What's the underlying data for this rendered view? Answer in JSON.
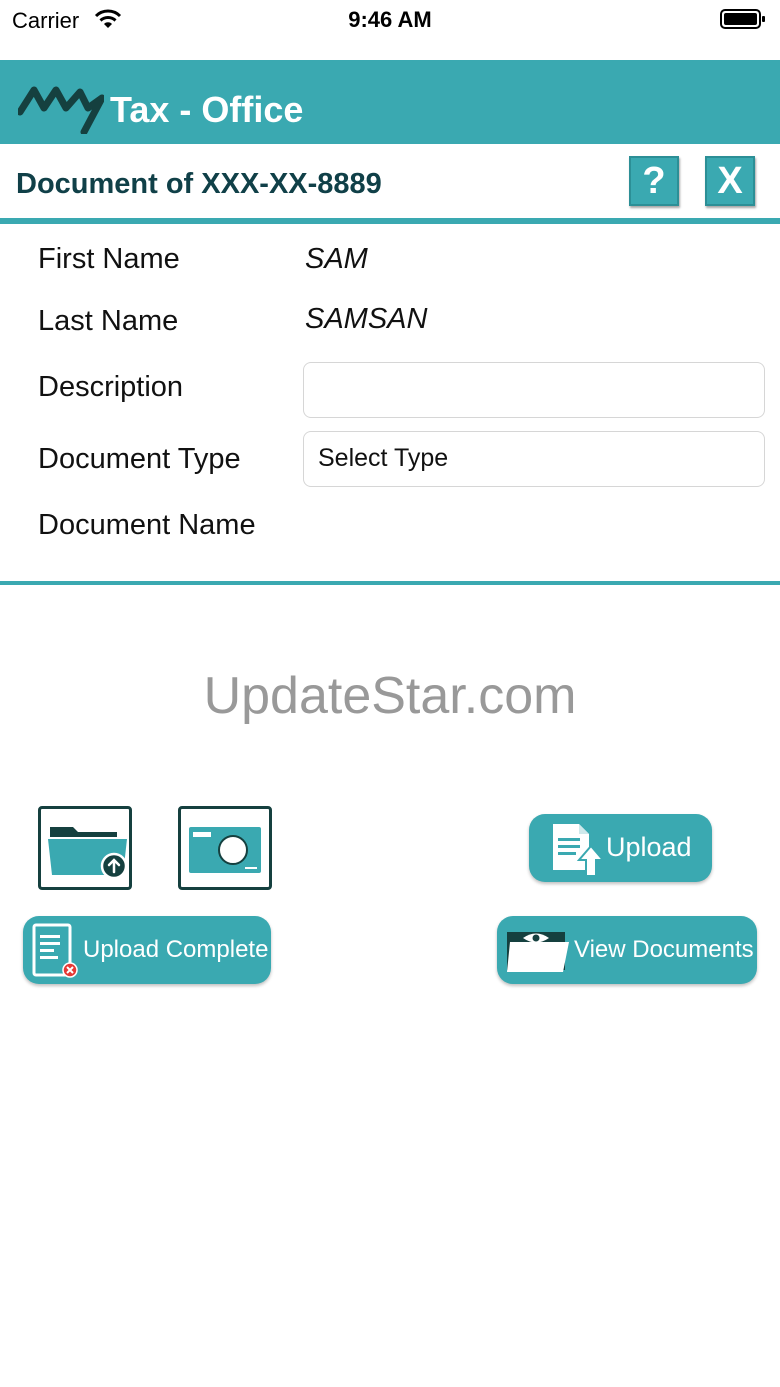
{
  "status_bar": {
    "carrier": "Carrier",
    "time": "9:46 AM",
    "icons": [
      "wifi-icon",
      "battery-icon"
    ]
  },
  "header": {
    "logo_icon": "my-logo-icon",
    "title": "Tax - Office",
    "color": "#3aa9b1"
  },
  "document_bar": {
    "title": "Document of XXX-XX-8889",
    "help_label": "?",
    "close_label": "X"
  },
  "form": {
    "first_name_label": "First Name",
    "first_name_value": "SAM",
    "last_name_label": "Last Name",
    "last_name_value": "SAMSAN",
    "description_label": "Description",
    "description_value": "",
    "document_type_label": "Document Type",
    "document_type_value": "Select Type",
    "document_name_label": "Document Name"
  },
  "watermark": "UpdateStar.com",
  "actions": {
    "folder_icon": "folder-upload-icon",
    "camera_icon": "camera-icon",
    "upload_label": "Upload",
    "upload_complete_label": "Upload Complete",
    "view_documents_label": "View Documents"
  },
  "colors": {
    "accent": "#3aa9b1",
    "dark": "#104048"
  }
}
